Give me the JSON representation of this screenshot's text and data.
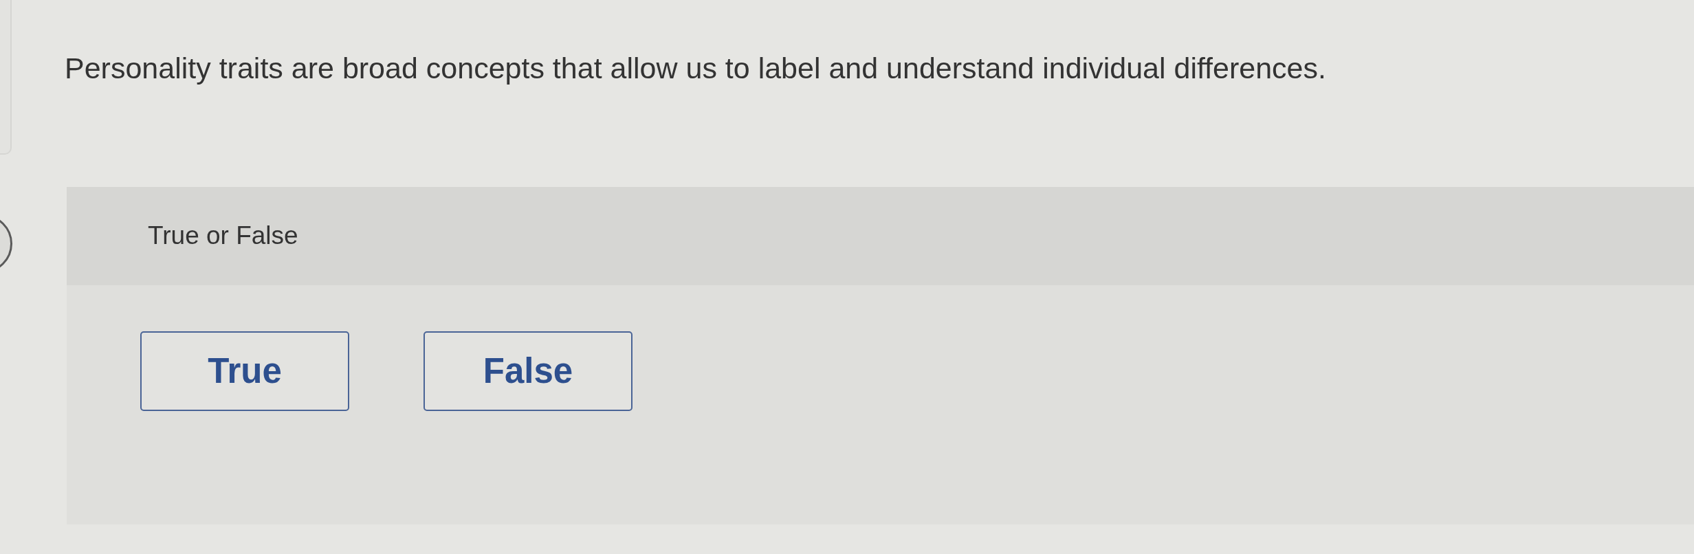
{
  "question": {
    "text": "Personality traits are broad concepts that allow us to label and understand individual differences."
  },
  "prompt": "True or False",
  "options": [
    {
      "label": "True",
      "selected": false
    },
    {
      "label": "False",
      "selected": false
    }
  ]
}
